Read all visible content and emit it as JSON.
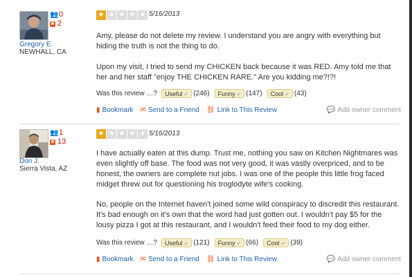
{
  "reviews": [
    {
      "user": {
        "name": "Gregory E.",
        "location": "NEWHALL, CA",
        "friends": "0",
        "reviews": "2"
      },
      "rating": 1,
      "date": "5/16/2013",
      "paragraphs": [
        "Amy, please do not delete my review. I understand you are angry with everything but hiding the truth is not the thing to do.",
        "Upon my visit, I tried to send my CHICKEN back because it was RED. Amy told me that her and her staff \"enjoy THE CHICKEN RARE.\" Are you kidding me?!?!"
      ],
      "votes": {
        "prompt": "Was this review …?",
        "useful_label": "Useful",
        "useful": "(246)",
        "funny_label": "Funny",
        "funny": "(147)",
        "cool_label": "Cool",
        "cool": "(43)"
      },
      "actions": {
        "bookmark": "Bookmark",
        "send": "Send to a Friend",
        "link": "Link to This Review",
        "owner_comment": "Add owner comment"
      }
    },
    {
      "user": {
        "name": "Don J.",
        "location": "Sierra Vista, AZ",
        "friends": "1",
        "reviews": "13"
      },
      "rating": 1,
      "date": "5/16/2013",
      "paragraphs": [
        "I have actually eaten at this dump. Trust me, nothing you saw on Kitchen Nightmares was even slightly off base. The food was not very good, it was vastly overpriced, and to be honest, the owners are complete nut jobs. I was one of the people this little frog faced midget threw out for questioning his troglodyte wife's cooking.",
        "No, people on the Internet haven't joined some wild conspiracy to discredit this restaurant. It's bad enough on it's own that the word had just gotten out. I wouldn't pay $5 for the lousy pizza I got at this restaurant, and I wouldn't feed their food to my dog either."
      ],
      "votes": {
        "prompt": "Was this review …?",
        "useful_label": "Useful",
        "useful": "(121)",
        "funny_label": "Funny",
        "funny": "(66)",
        "cool_label": "Cool",
        "cool": "(39)"
      },
      "actions": {
        "bookmark": "Bookmark",
        "send": "Send to a Friend",
        "link": "Link to This Review",
        "owner_comment": "Add owner comment"
      }
    }
  ],
  "icons": {
    "friends": "friends-icon",
    "reviews": "review-count-icon",
    "bookmark": "bookmark-icon",
    "send": "envelope-icon",
    "link": "link-icon",
    "owner_comment": "speech-bubble-icon",
    "star": "star-icon"
  },
  "colors": {
    "star_on": "#e8a71a",
    "star_off": "#dcdcdc",
    "link": "#1b5ea8",
    "accent": "#e05a1a",
    "vote_bg": "#f5efc9"
  }
}
